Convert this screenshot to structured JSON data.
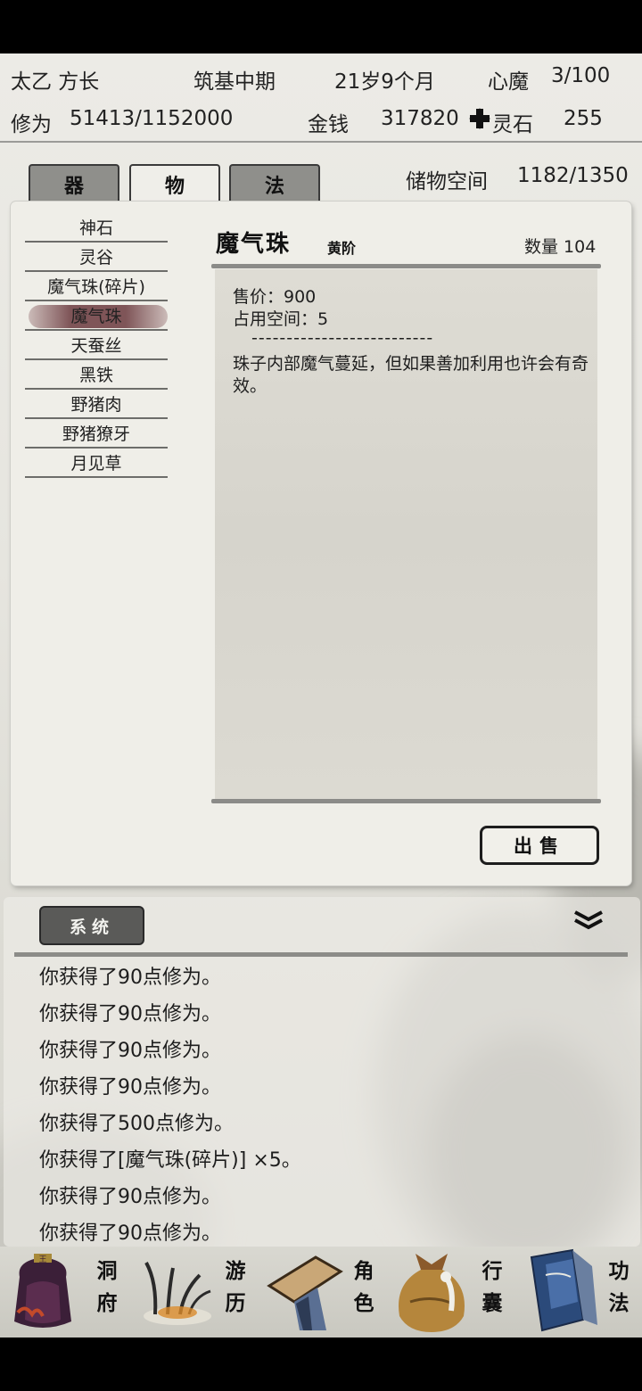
{
  "stats": {
    "name": "太乙 方长",
    "realm": "筑基中期",
    "age": "21岁9个月",
    "heart_demon_label": "心魔",
    "heart_demon_value": "3/100",
    "cultivation_label": "修为",
    "cultivation_value": "51413/1152000",
    "money_label": "金钱",
    "money_value": "317820",
    "spirit_stone_label": "灵石",
    "spirit_stone_value": "255"
  },
  "tabs": [
    {
      "label": "器",
      "active": false
    },
    {
      "label": "物",
      "active": true
    },
    {
      "label": "法",
      "active": false
    }
  ],
  "storage": {
    "label": "储物空间",
    "value": "1182/1350"
  },
  "items": [
    {
      "label": "神石",
      "selected": false
    },
    {
      "label": "灵谷",
      "selected": false
    },
    {
      "label": "魔气珠(碎片)",
      "selected": false
    },
    {
      "label": "魔气珠",
      "selected": true
    },
    {
      "label": "天蚕丝",
      "selected": false
    },
    {
      "label": "黑铁",
      "selected": false
    },
    {
      "label": "野猪肉",
      "selected": false
    },
    {
      "label": "野猪獠牙",
      "selected": false
    },
    {
      "label": "月见草",
      "selected": false
    }
  ],
  "detail": {
    "name": "魔气珠",
    "grade": "黄阶",
    "quantity": "数量 104",
    "price": "售价：900",
    "space": "占用空间：5",
    "separator": "--------------------------",
    "description": "珠子内部魔气蔓延，但如果善加利用也许会有奇效。"
  },
  "sell_button": "出售",
  "log": {
    "tab_label": "系统",
    "lines": [
      "你获得了90点修为。",
      "你获得了90点修为。",
      "你获得了90点修为。",
      "你获得了90点修为。",
      "你获得了500点修为。",
      "你获得了[魔气珠(碎片)] ×5。",
      "你获得了90点修为。",
      "你获得了90点修为。"
    ]
  },
  "nav": [
    {
      "label1": "洞",
      "label2": "府",
      "icon": "cave-dwelling-icon"
    },
    {
      "label1": "游",
      "label2": "历",
      "icon": "travel-grass-icon"
    },
    {
      "label1": "角",
      "label2": "色",
      "icon": "character-hat-icon"
    },
    {
      "label1": "行",
      "label2": "囊",
      "icon": "bag-icon"
    },
    {
      "label1": "功",
      "label2": "法",
      "icon": "scroll-book-icon"
    }
  ],
  "colors": {
    "panel": "#efeee8",
    "selected_item": "#7f5558",
    "system_button": "#5a5a58"
  }
}
